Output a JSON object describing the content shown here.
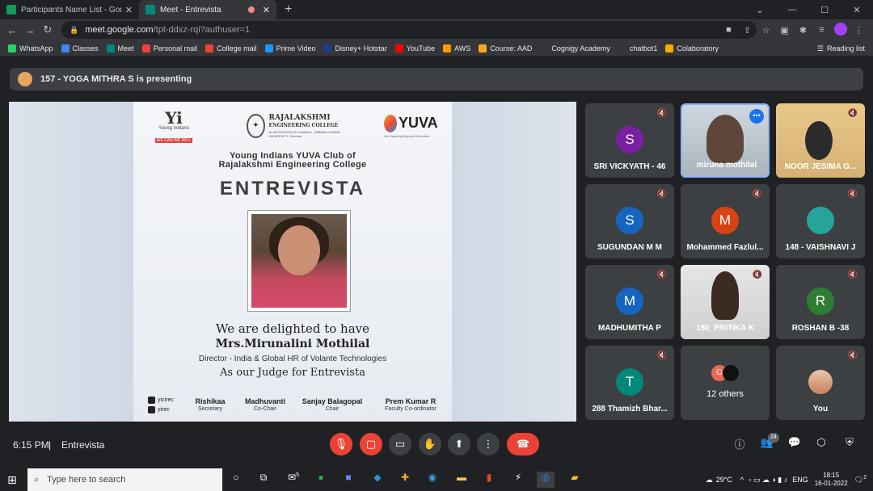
{
  "browser": {
    "tabs": [
      {
        "label": "Participants Name List - Google",
        "favicon_color": "#0f9d58"
      },
      {
        "label": "Meet - Entrevista",
        "favicon_color": "#00897b"
      }
    ],
    "new_tab_symbol": "+",
    "url_host": "meet.google.com",
    "url_path": "/tpt-ddxz-rqi?authuser=1",
    "bookmarks": [
      {
        "label": "WhatsApp",
        "color": "#25d366"
      },
      {
        "label": "Classes",
        "color": "#4285f4"
      },
      {
        "label": "Meet",
        "color": "#00897b"
      },
      {
        "label": "Personal mail",
        "color": "#ea4335"
      },
      {
        "label": "College mail",
        "color": "#ea4335"
      },
      {
        "label": "Prime Video",
        "color": "#1a98ff"
      },
      {
        "label": "Disney+ Hotstar",
        "color": "#1f3b8f"
      },
      {
        "label": "YouTube",
        "color": "#ff0000"
      },
      {
        "label": "AWS",
        "color": "#ff9900"
      },
      {
        "label": "Course: AAD",
        "color": "#f9a825"
      },
      {
        "label": "Cognigy Academy",
        "color": "#35363a"
      },
      {
        "label": "chatbot1",
        "color": "#35363a"
      },
      {
        "label": "Colaboratory",
        "color": "#f9ab00"
      }
    ],
    "reading_list": "Reading list"
  },
  "meet": {
    "presenting_banner": "157 - YOGA MITHRA S is presenting",
    "participants": [
      {
        "name": "SRI VICKYATH - 46",
        "initial": "S",
        "color": "#7b1fa2",
        "muted": true
      },
      {
        "name": "miruna mothilal",
        "video": "1",
        "muted": false,
        "selected": true
      },
      {
        "name": "NOOR JESIMA G...",
        "video": "2",
        "muted": true
      },
      {
        "name": "SUGUNDAN M M",
        "initial": "S",
        "color": "#1565c0",
        "muted": true
      },
      {
        "name": "Mohammed Fazlul...",
        "initial": "M",
        "color": "#d84315",
        "muted": true
      },
      {
        "name": "148 - VAISHNAVI J",
        "initial": "",
        "color": "#26a69a",
        "muted": true
      },
      {
        "name": "MADHUMITHA P",
        "initial": "M",
        "color": "#1565c0",
        "muted": true
      },
      {
        "name": "180_PRITIKA K",
        "video": "3",
        "muted": true
      },
      {
        "name": "ROSHAN B -38",
        "initial": "R",
        "color": "#2e7d32",
        "muted": true
      },
      {
        "name": "288 Thamizh Bhar...",
        "initial": "T",
        "color": "#00897b",
        "muted": true
      },
      {
        "name": "12 others",
        "others": true,
        "others_initial": "G"
      },
      {
        "name": "You",
        "you": true,
        "muted": true
      }
    ],
    "more_options_symbol": "•••",
    "time": "6:15 PM",
    "meeting_name": "Entrevista",
    "participant_count": "24"
  },
  "poster": {
    "yi_logo": "Yi",
    "yi_name": "Young Indians",
    "yi_tagline": "WE CAN WE WILL",
    "college_line1": "RAJALAKSHMI",
    "college_line2": "ENGINEERING COLLEGE",
    "college_sub": "An AUTONOMOUS Institution · Affiliated to ANNA UNIVERSITY, Chennai",
    "yuva": "YUVA",
    "yuva_tag": "We Sparking Beyond Education",
    "club_line1": "Young Indians YUVA Club of",
    "club_line2": "Rajalakshmi Engineering College",
    "event": "ENTREVISTA",
    "delighted": "We are delighted to have",
    "judge_name": "Mrs.Mirunalini  Mothilal",
    "judge_role": "Director - India & Global HR of Volante Technologies",
    "judge_for": "As our Judge for Entrevista",
    "social_instagram": "yicirec",
    "social_facebook": "yirec",
    "signatories": [
      {
        "name": "Rishikaa",
        "role": "Secretary"
      },
      {
        "name": "Madhuvanti",
        "role": "Co-Chair"
      },
      {
        "name": "Sanjay Balagopal",
        "role": "Chair"
      },
      {
        "name": "Prem Kumar R",
        "role": "Faculty Co-ordinator"
      }
    ]
  },
  "taskbar": {
    "search_placeholder": "Type here to search",
    "weather": "29°C",
    "language": "ENG",
    "time": "18:15",
    "date": "16-01-2022",
    "mail_badge": "5",
    "notification_badge": "2"
  },
  "colors": {
    "end_call": "#ea4335",
    "muted_red": "#ea4335",
    "accent": "#8ab4f8"
  }
}
